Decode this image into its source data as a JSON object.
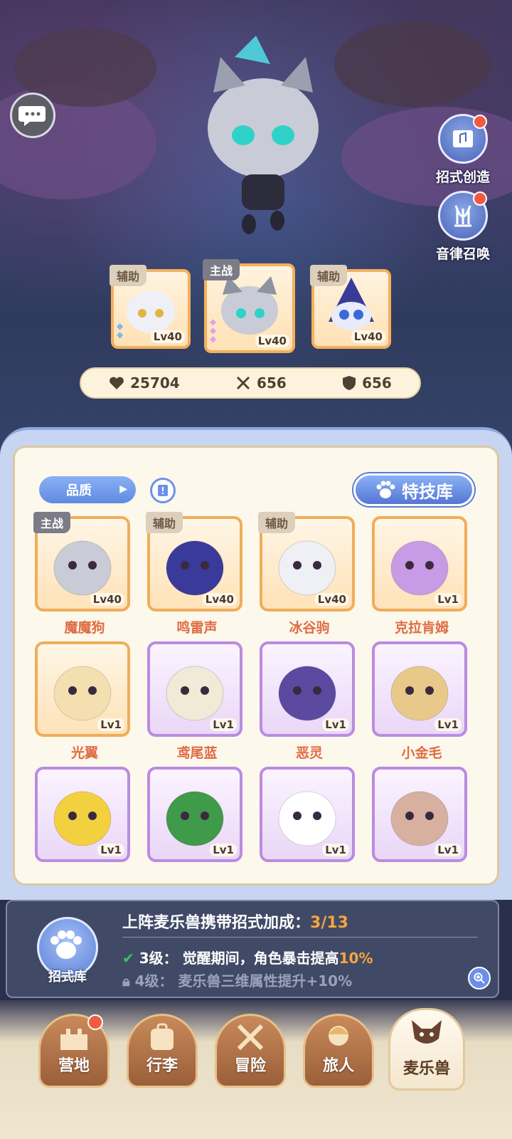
{
  "side_buttons": {
    "move_create": "招式创造",
    "melody_summon": "音律召唤"
  },
  "team": [
    {
      "role": "辅助",
      "level": "Lv40"
    },
    {
      "role": "主战",
      "level": "Lv40"
    },
    {
      "role": "辅助",
      "level": "Lv40"
    }
  ],
  "stats": {
    "hp": "25704",
    "attack": "656",
    "defense": "656"
  },
  "panel": {
    "filter_label": "品质",
    "skill_library_label": "特技库"
  },
  "pets": [
    {
      "name": "魔魔狗",
      "role": "主战",
      "level": "Lv40",
      "frame": "orange"
    },
    {
      "name": "鸣雷声",
      "role": "辅助",
      "level": "Lv40",
      "frame": "orange"
    },
    {
      "name": "冰谷驹",
      "role": "辅助",
      "level": "Lv40",
      "frame": "orange"
    },
    {
      "name": "克拉肯姆",
      "role": "",
      "level": "Lv1",
      "frame": "orange"
    },
    {
      "name": "光翼",
      "role": "",
      "level": "Lv1",
      "frame": "orange"
    },
    {
      "name": "鸢尾蓝",
      "role": "",
      "level": "Lv1",
      "frame": "purple"
    },
    {
      "name": "恶灵",
      "role": "",
      "level": "Lv1",
      "frame": "purple"
    },
    {
      "name": "小金毛",
      "role": "",
      "level": "Lv1",
      "frame": "purple"
    },
    {
      "name": "",
      "role": "",
      "level": "Lv1",
      "frame": "purple"
    },
    {
      "name": "",
      "role": "",
      "level": "Lv1",
      "frame": "purple"
    },
    {
      "name": "",
      "role": "",
      "level": "Lv1",
      "frame": "purple"
    },
    {
      "name": "",
      "role": "",
      "level": "Lv1",
      "frame": "purple"
    }
  ],
  "bonus": {
    "library_label": "招式库",
    "title": "上阵麦乐兽携带招式加成：",
    "count": "3/13",
    "tier1_level": "3级：",
    "tier1_text": "觉醒期间，角色暴击提高",
    "tier1_pct": "10%",
    "tier2_level": "4级：",
    "tier2_text": "麦乐兽三维属性提升+10%"
  },
  "nav": [
    "营地",
    "行李",
    "冒险",
    "旅人",
    "麦乐兽"
  ],
  "colors": {
    "orange_frame": "#f0ad5a",
    "purple_frame": "#bb8be0",
    "accent_blue": "#5f8ae0",
    "name_orange": "#e06b42",
    "highlight": "#f5a63a"
  }
}
